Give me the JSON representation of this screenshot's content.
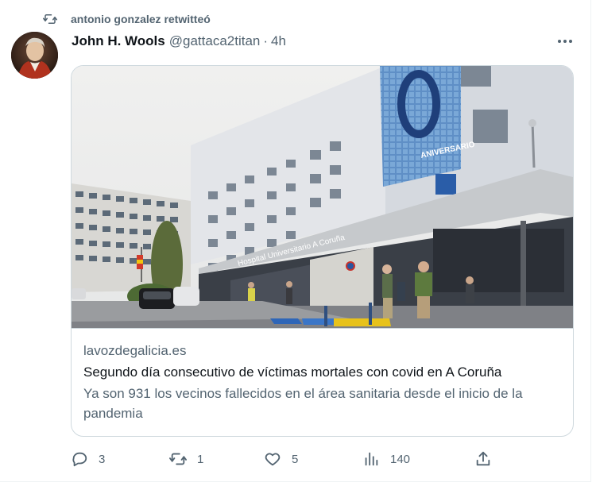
{
  "retweet": {
    "text": "antonio gonzalez retwitteó",
    "icon": "retweet-icon"
  },
  "tweet": {
    "display_name": "John H. Wools",
    "handle": "@gattaca2titan",
    "separator": "·",
    "time": "4h"
  },
  "card": {
    "domain": "lavozdegalicia.es",
    "title": "Segundo día consecutivo de víctimas mortales con covid en A Coruña",
    "description": "Ya son 931 los vecinos fallecidos en el área sanitaria desde el inicio de la pandemia",
    "image_text": {
      "hospital_sign": "Hospital Universitario A Coruña",
      "banner_digit": "0",
      "banner_word": "ANIVERSARIO"
    }
  },
  "actions": {
    "replies": "3",
    "retweets": "1",
    "likes": "5",
    "views": "140"
  },
  "colors": {
    "text_primary": "#0f1419",
    "text_secondary": "#536471",
    "border": "#cfd9de"
  }
}
